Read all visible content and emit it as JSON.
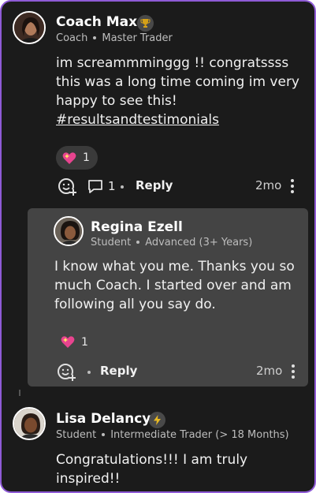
{
  "comment1": {
    "author": "Coach Max",
    "badge_icon": "trophy-icon",
    "role": "Coach",
    "level": "Master Trader",
    "text": "im screammminggg !! congratssss this was a long time coming im very happy to see this!",
    "hashtag": "#resultsandtestimonials",
    "reaction_count": "1",
    "comment_count": "1",
    "reply_label": "Reply",
    "age": "2mo"
  },
  "reply1": {
    "author": "Regina Ezell",
    "role": "Student",
    "level": "Advanced (3+ Years)",
    "text": "I know what you me.  Thanks you so much Coach. I started over and am following all you say do.",
    "reaction_count": "1",
    "reply_label": "Reply",
    "age": "2mo"
  },
  "comment2": {
    "author": "Lisa Delancy",
    "badge_icon": "lightning-icon",
    "role": "Student",
    "level": "Intermediate Trader (> 18 Months)",
    "text": "Congratulations!!! I am truly inspired!!"
  },
  "colors": {
    "background": "#1b1b1b",
    "reply_card": "#444444",
    "frame_border": "#8f5bd6",
    "reaction_heart": "#e8448f"
  }
}
